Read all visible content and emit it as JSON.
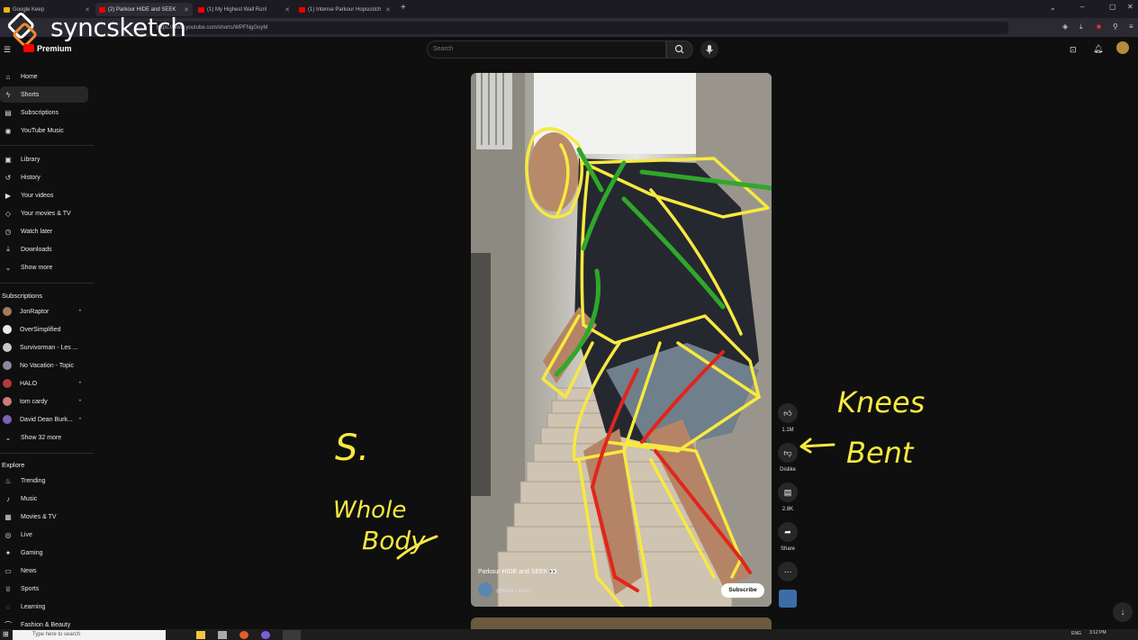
{
  "browser": {
    "tabs": [
      {
        "label": "Google Keep",
        "active": false
      },
      {
        "label": "(2) Parkour HIDE and SEEK",
        "active": true
      },
      {
        "label": "(1) My Highest Wall Run!",
        "active": false
      },
      {
        "label": "(1) Intense Parkour Hopscotch",
        "active": false
      }
    ],
    "new_tab": "+",
    "url": "https://www.youtube.com/shorts/WPFNgGoyM"
  },
  "logo": {
    "text": "syncsketch"
  },
  "youtube": {
    "brand": "Premium",
    "search_placeholder": "Search",
    "sidebar": {
      "main": [
        "Home",
        "Shorts",
        "Subscriptions",
        "YouTube Music"
      ],
      "library": [
        "Library",
        "History",
        "Your videos",
        "Your movies & TV",
        "Watch later",
        "Downloads",
        "Show more"
      ],
      "subscriptions_heading": "Subscriptions",
      "subscriptions": [
        {
          "name": "JonRaptor",
          "color": "#a07c5a"
        },
        {
          "name": "OverSimplified",
          "color": "#e9e9e9"
        },
        {
          "name": "Survivorman - Les ...",
          "color": "#c8c8c8"
        },
        {
          "name": "No Vacation - Topic",
          "color": "#8a8a9a"
        },
        {
          "name": "HALO",
          "color": "#b43a3a"
        },
        {
          "name": "tom cardy",
          "color": "#d07a7a"
        },
        {
          "name": "David Dean Burk...",
          "color": "#7b63b3"
        }
      ],
      "show_more_subs": "Show 32 more",
      "explore_heading": "Explore",
      "explore": [
        "Trending",
        "Music",
        "Movies & TV",
        "Live",
        "Gaming",
        "News",
        "Sports",
        "Learning",
        "Fashion & Beauty"
      ]
    },
    "video": {
      "title": "Parkour HIDE and SEEK 👀",
      "channel": "@Matt Lenzo",
      "subscribe": "Subscribe"
    },
    "actions": {
      "likes": "1.1M",
      "dislike": "Dislike",
      "comments": "2.8K",
      "share": "Share"
    }
  },
  "annotations": {
    "s_label": "S.",
    "whole": "Whole",
    "body": "Body",
    "knees": "Knees",
    "bent": "Bent"
  },
  "taskbar": {
    "search_placeholder": "Type here to search",
    "lang": "ENG",
    "time": "3:12 PM"
  },
  "colors": {
    "sketch_yellow": "#f7e93f",
    "sketch_green": "#2ea82a",
    "sketch_red": "#e3241b"
  }
}
